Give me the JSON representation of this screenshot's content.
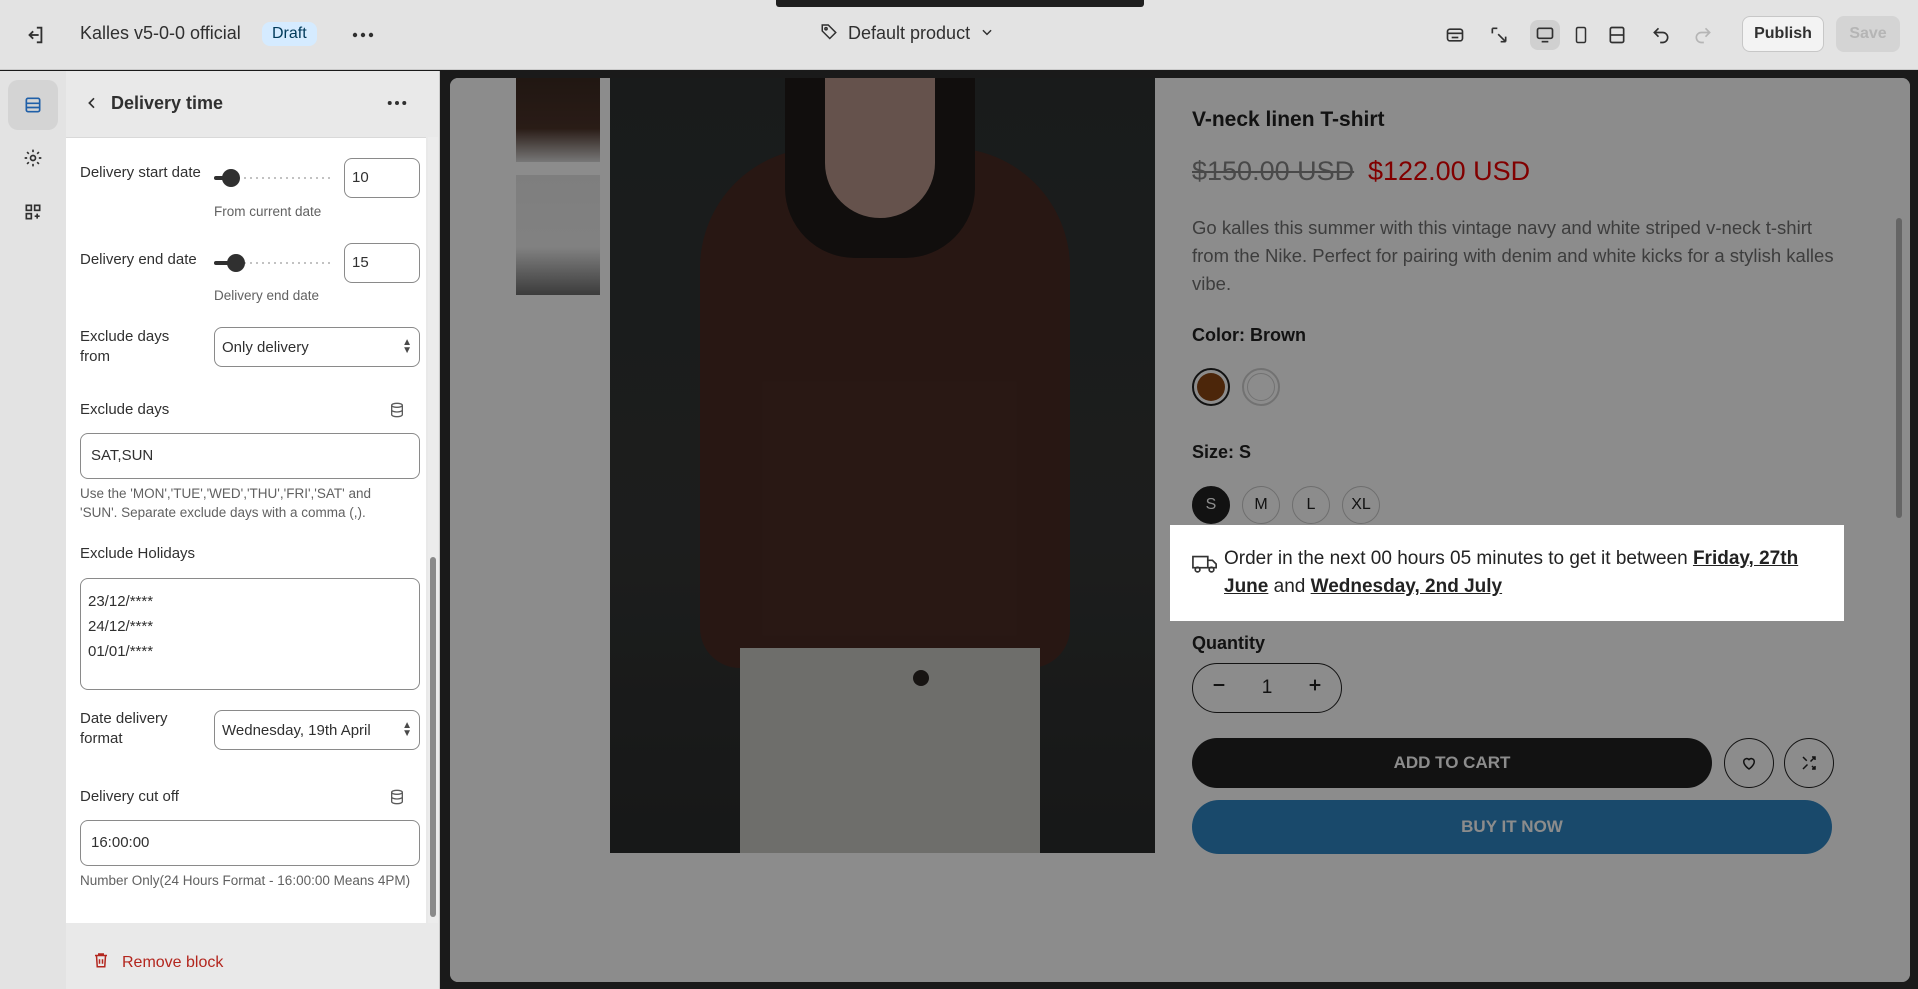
{
  "topbar": {
    "store_name": "Kalles v5-0-0 official",
    "status_badge": "Draft",
    "template_selector": "Default product",
    "publish_label": "Publish",
    "save_label": "Save"
  },
  "sidebar": {
    "title": "Delivery time",
    "fields": {
      "start_date": {
        "label": "Delivery start date",
        "value": "10",
        "help": "From current date",
        "slider_fraction": 0.1
      },
      "end_date": {
        "label": "Delivery end date",
        "value": "15",
        "help": "Delivery end date",
        "slider_fraction": 0.15
      },
      "exclude_from": {
        "label": "Exclude days from",
        "value": "Only delivery"
      },
      "exclude_days": {
        "label": "Exclude days",
        "value": "SAT,SUN",
        "help": "Use the 'MON','TUE','WED','THU','FRI','SAT' and 'SUN'. Separate exclude days with a comma (,)."
      },
      "exclude_holidays": {
        "label": "Exclude Holidays",
        "lines": [
          "23/12/****",
          "24/12/****",
          "01/01/****"
        ]
      },
      "date_format": {
        "label": "Date delivery format",
        "value": "Wednesday, 19th April"
      },
      "cut_off": {
        "label": "Delivery cut off",
        "value": "16:00:00",
        "help": "Number Only(24 Hours Format - 16:00:00 Means 4PM)"
      }
    },
    "remove_label": "Remove block"
  },
  "product": {
    "title": "V-neck linen T-shirt",
    "price_old": "$150.00 USD",
    "price_new": "$122.00 USD",
    "description": "Go kalles this summer with this vintage navy and white striped v-neck t-shirt from the Nike. Perfect for pairing with denim and white kicks for a stylish kalles vibe.",
    "color_label": "Color: Brown",
    "colors": [
      "#8b4513",
      "#ffffff"
    ],
    "size_label": "Size: S",
    "sizes": [
      "S",
      "M",
      "L",
      "XL"
    ],
    "delivery_msg_prefix": "Order in the next 00 hours 05 minutes to get it between",
    "delivery_date_1": "Friday, 27th June",
    "delivery_and": "and",
    "delivery_date_2": "Wednesday, 2nd July",
    "quantity_label": "Quantity",
    "quantity_value": "1",
    "add_to_cart": "ADD TO CART",
    "buy_now": "BUY IT NOW"
  },
  "icons": [
    "exit-icon",
    "more-icon",
    "tag-icon",
    "chevron-down-icon",
    "store-icon",
    "inspector-icon",
    "desktop-icon",
    "mobile-icon",
    "fullwidth-icon",
    "undo-icon",
    "redo-icon",
    "sections-icon",
    "settings-icon",
    "apps-icon",
    "back-icon",
    "database-icon",
    "trash-icon",
    "truck-icon",
    "minus-icon",
    "plus-icon",
    "heart-icon",
    "compare-icon"
  ]
}
